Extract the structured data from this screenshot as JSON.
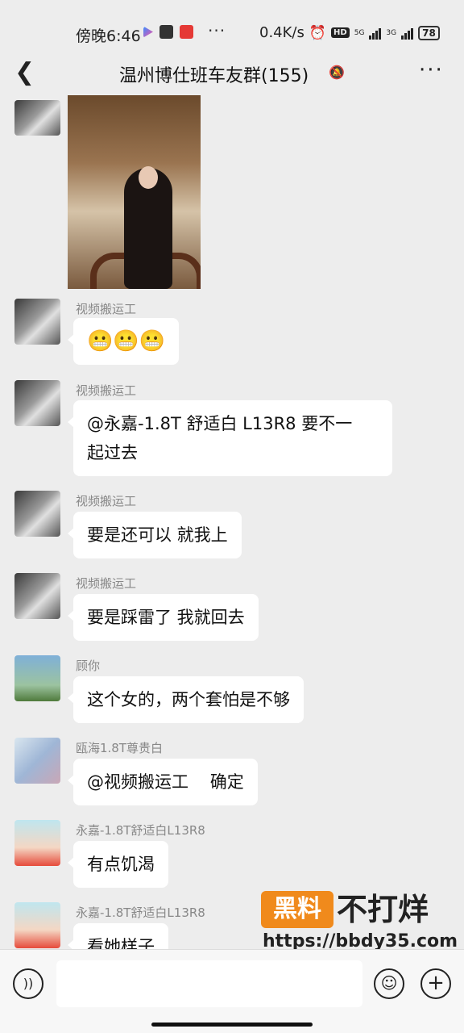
{
  "status_bar": {
    "time": "傍晚6:46",
    "more": "···",
    "net_speed": "0.4K/s",
    "hd": "HD",
    "net1": "5G",
    "net2": "3G",
    "battery": "78"
  },
  "header": {
    "back_icon": "chevron-left-icon",
    "title": "温州博仕班车友群(155)",
    "mute_icon": "bell-muted-icon",
    "menu": "···"
  },
  "messages": [
    {
      "sender": "视频搬运工",
      "text": "😬😬😬"
    },
    {
      "sender": "视频搬运工",
      "text_line1": "@永嘉-1.8T 舒适白 L13R8  要不一",
      "text_line2": "起过去"
    },
    {
      "sender": "视频搬运工",
      "text": "要是还可以 就我上"
    },
    {
      "sender": "视频搬运工",
      "text": "要是踩雷了 我就回去"
    },
    {
      "sender": "顾你",
      "text": "这个女的，两个套怕是不够"
    },
    {
      "sender": "瓯海1.8T尊贵白",
      "text": "@视频搬运工    确定"
    },
    {
      "sender": "永嘉-1.8T舒适白L13R8",
      "text": "有点饥渴"
    },
    {
      "sender": "永嘉-1.8T舒适白L13R8",
      "text": "看她样子"
    }
  ],
  "watermark": {
    "tag": "黑料",
    "main": "不打烊",
    "url": "https://bbdy35.com"
  },
  "input_bar": {
    "voice_icon": "voice-icon",
    "emoji_icon": "emoji-icon",
    "plus_icon": "plus-icon"
  }
}
